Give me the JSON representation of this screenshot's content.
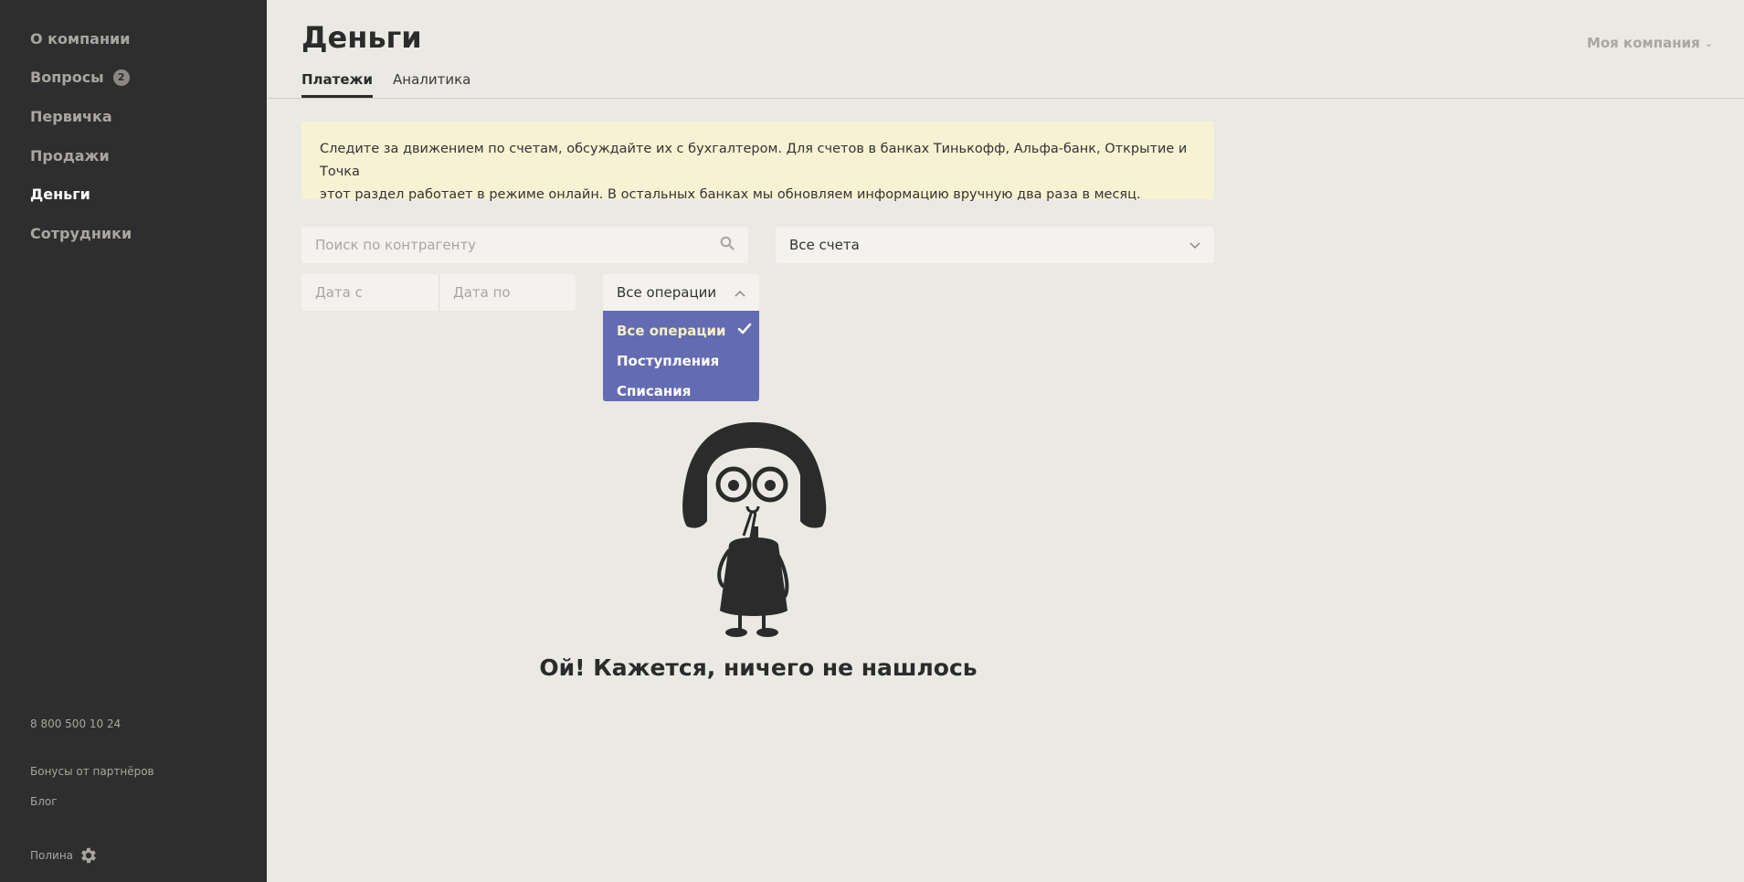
{
  "sidebar": {
    "items": [
      {
        "label": "О компании"
      },
      {
        "label": "Вопросы",
        "badge": "2"
      },
      {
        "label": "Первичка"
      },
      {
        "label": "Продажи"
      },
      {
        "label": "Деньги",
        "active": true
      },
      {
        "label": "Сотрудники"
      }
    ],
    "phone": "8 800 500 10 24",
    "partners_link": "Бонусы от партнёров",
    "blog_link": "Блог",
    "user_name": "Полина"
  },
  "header": {
    "title": "Деньги",
    "company_switch": "Моя компания",
    "tabs": [
      {
        "label": "Платежи",
        "active": true
      },
      {
        "label": "Аналитика",
        "active": false
      }
    ]
  },
  "notice": {
    "line1": "Следите за движением по счетам, обсуждайте их с бухгалтером. Для счетов в банках Тинькофф, Альфа-банк, Открытие и Точка",
    "line2": "этот раздел работает в режиме онлайн. В остальных банках мы обновляем информацию вручную два раза в месяц."
  },
  "filters": {
    "search_placeholder": "Поиск по контрагенту",
    "accounts_value": "Все счета",
    "date_from_placeholder": "Дата с",
    "date_to_placeholder": "Дата по",
    "operations_value": "Все операции",
    "operations_options": [
      "Все операции",
      "Поступления",
      "Списания"
    ],
    "operations_selected_index": 0
  },
  "empty_state": {
    "message": "Ой! Кажется, ничего не нашлось"
  },
  "colors": {
    "sidebar_bg": "#2e2e2e",
    "page_bg": "#ebe9e4",
    "notice_bg": "#f7f2d3",
    "dropdown_bg": "#636bb2"
  }
}
